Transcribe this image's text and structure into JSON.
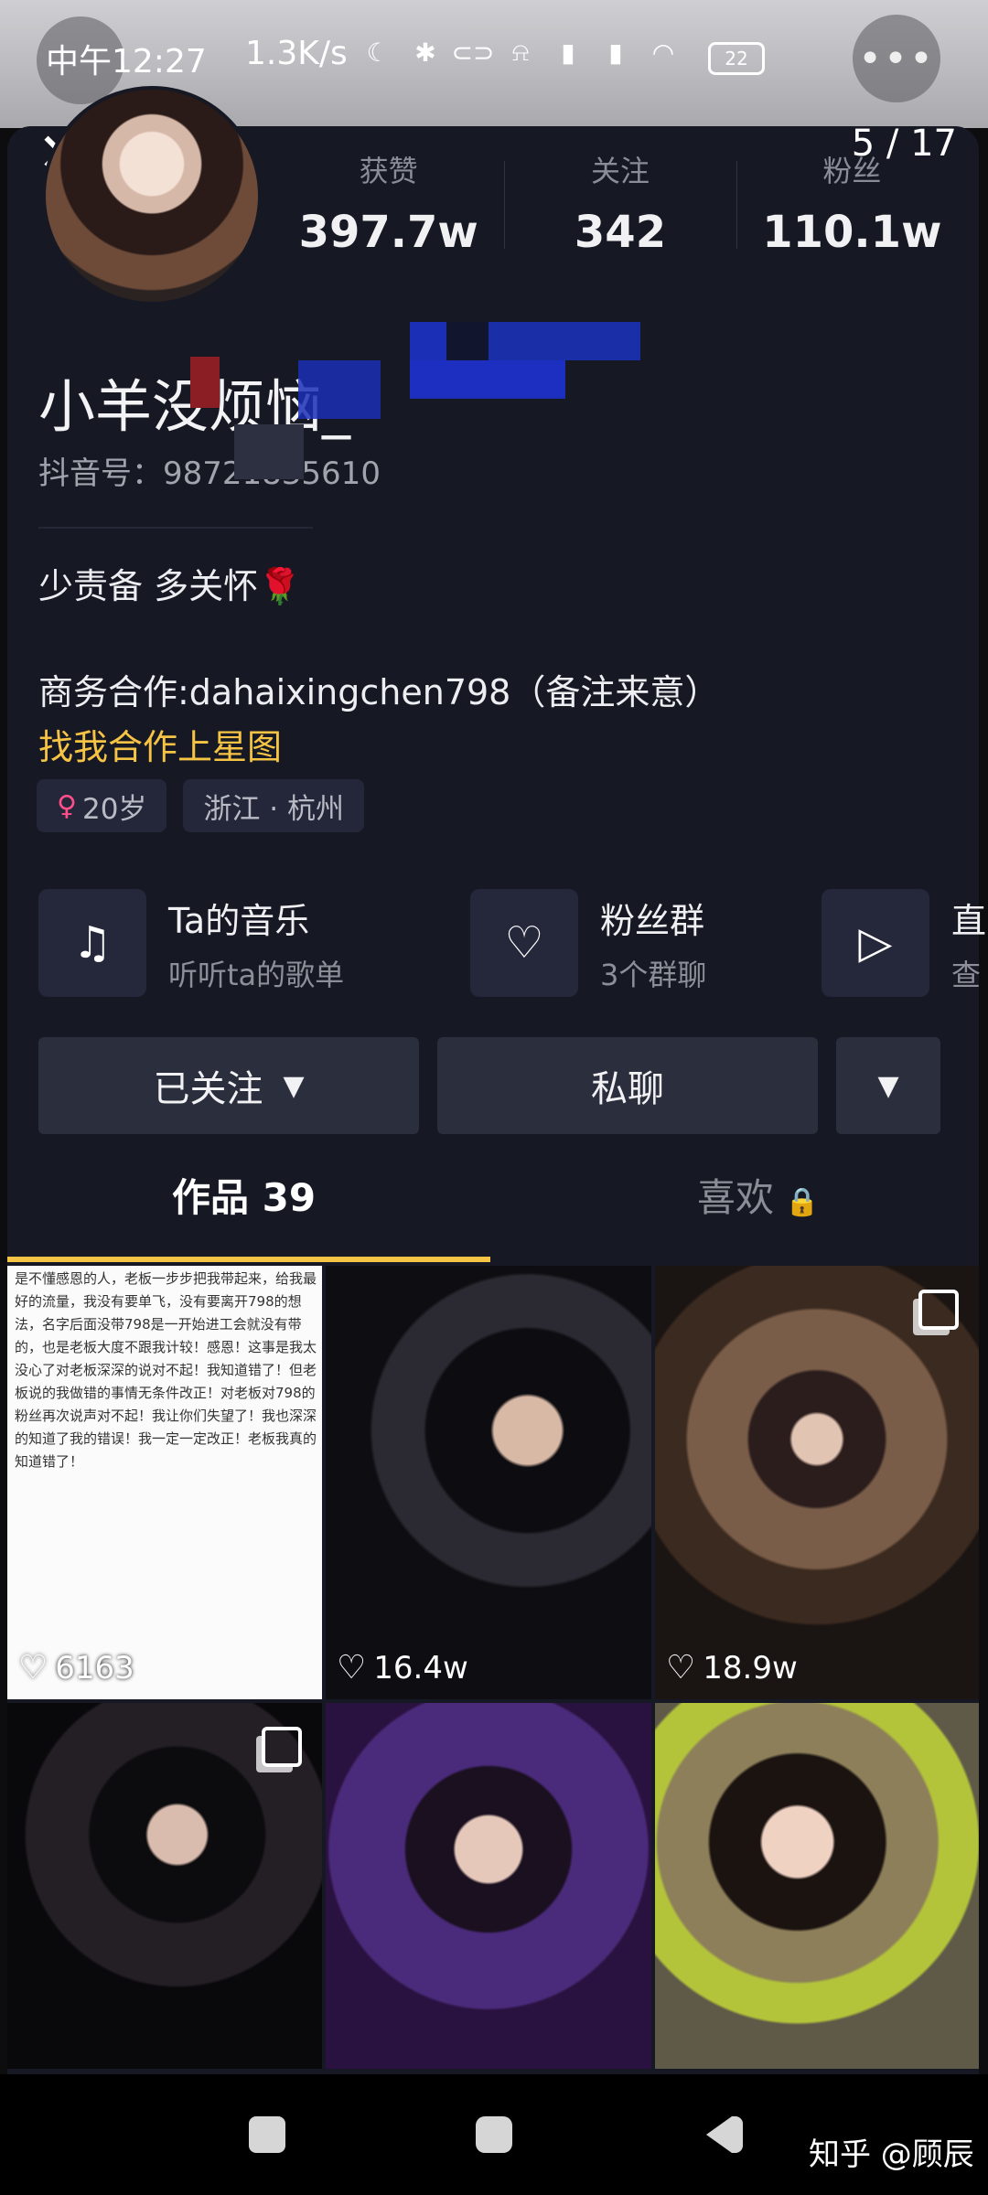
{
  "status_bar": {
    "time": "中午12:27",
    "speed": "1.3K/s",
    "battery": "22"
  },
  "header": {
    "page_counter": "5 / 17"
  },
  "profile": {
    "stats": [
      {
        "label": "获赞",
        "value": "397.7w"
      },
      {
        "label": "关注",
        "value": "342"
      },
      {
        "label": "粉丝",
        "value": "110.1w"
      }
    ],
    "username": "小羊没烦恼_",
    "account_id": "抖音号：98721835610",
    "bio": "少责备 多关怀🌹",
    "business": "商务合作:dahaixingchen798（备注来意）",
    "star_link": "找我合作上星图",
    "tags": {
      "age": "20岁",
      "location": "浙江 · 杭州"
    }
  },
  "features": [
    {
      "title": "Ta的音乐",
      "subtitle": "听听ta的歌单",
      "icon": "music-note-icon"
    },
    {
      "title": "粉丝群",
      "subtitle": "3个群聊",
      "icon": "fan-group-icon"
    },
    {
      "title": "直",
      "subtitle": "查",
      "icon": "live-tv-icon"
    }
  ],
  "actions": {
    "following": "已关注",
    "message": "私聊"
  },
  "tabs": {
    "works": "作品 39",
    "likes": "喜欢"
  },
  "posts": [
    {
      "likes": "6163",
      "kind": "text-note"
    },
    {
      "likes": "16.4w",
      "kind": "photo"
    },
    {
      "likes": "18.9w",
      "kind": "album"
    },
    {
      "likes": "",
      "kind": "album"
    },
    {
      "likes": "",
      "kind": "photo"
    },
    {
      "likes": "",
      "kind": "photo"
    }
  ],
  "note_post_text": "是不懂感恩的人，老板一步步把我带起来，给我最好的流量，我没有要单飞，没有要离开798的想法，名字后面没带798是一开始进工会就没有带的，也是老板大度不跟我计较！感恩！这事是我太没心了对老板深深的说对不起！我知道错了！但老板说的我做错的事情无条件改正！对老板对798的粉丝再次说声对不起！我让你们失望了！我也深深的知道了我的错误！我一定一定改正！老板我真的知道错了！",
  "watermark": "知乎 @顾辰"
}
